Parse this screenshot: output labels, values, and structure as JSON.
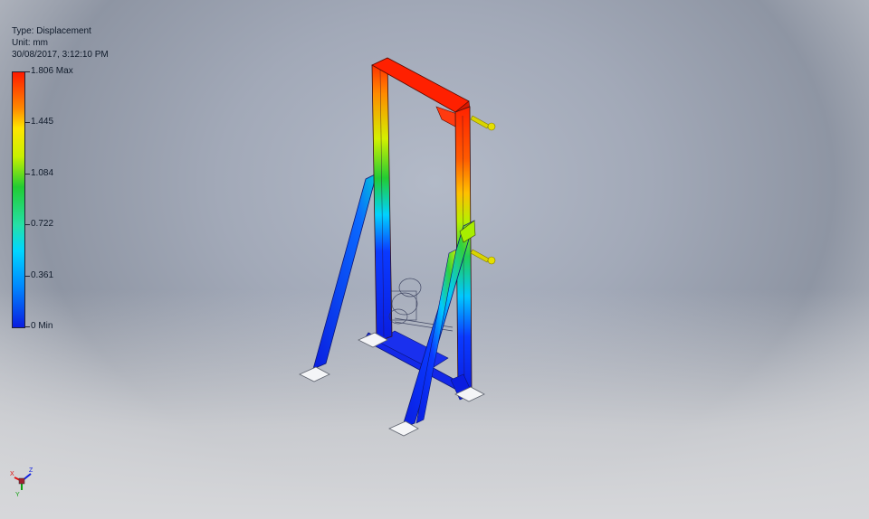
{
  "result_info": {
    "type_line": "Type: Displacement",
    "unit_line": "Unit: mm",
    "date_line": "30/08/2017, 3:12:10 PM"
  },
  "legend": {
    "ticks": [
      {
        "label": "1.806 Max",
        "value": 1.806
      },
      {
        "label": "1.445",
        "value": 1.445
      },
      {
        "label": "1.084",
        "value": 1.084
      },
      {
        "label": "0.722",
        "value": 0.722
      },
      {
        "label": "0.361",
        "value": 0.361
      },
      {
        "label": "0 Min",
        "value": 0
      }
    ],
    "colors": [
      "#ff1a00",
      "#ff8800",
      "#ffe600",
      "#c8f000",
      "#22cc33",
      "#25e0a8",
      "#00d6ff",
      "#0088ff",
      "#0a1de0"
    ]
  },
  "model": {
    "name_icon": "displacement-frame-model",
    "load_arrow_color": "#d8d400"
  },
  "triad": {
    "axes": [
      "X",
      "Y",
      "Z"
    ],
    "colors": {
      "X": "#e01010",
      "Y": "#10a010",
      "Z": "#1020e0"
    }
  }
}
